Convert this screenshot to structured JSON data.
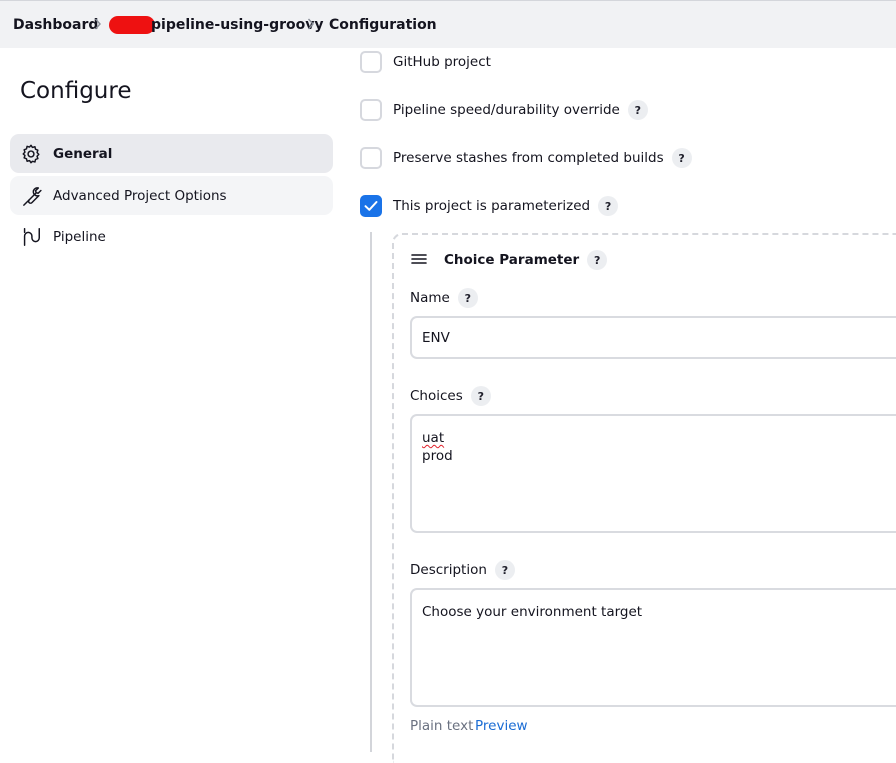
{
  "breadcrumb": {
    "dashboard": "Dashboard",
    "job": "pipeline-using-groovy",
    "current": "Configuration"
  },
  "page": {
    "title": "Configure"
  },
  "sidebar": {
    "items": [
      {
        "label": "General",
        "icon": "gear-icon",
        "active": true
      },
      {
        "label": "Advanced Project Options",
        "icon": "wrench-icon"
      },
      {
        "label": "Pipeline",
        "icon": "pipeline-icon"
      }
    ]
  },
  "options": [
    {
      "label": "GitHub project",
      "checked": false,
      "help": false
    },
    {
      "label": "Pipeline speed/durability override",
      "checked": false,
      "help": true
    },
    {
      "label": "Preserve stashes from completed builds",
      "checked": false,
      "help": true
    },
    {
      "label": "This project is parameterized",
      "checked": true,
      "help": true
    }
  ],
  "help_glyph": "?",
  "parameter": {
    "type": "Choice Parameter",
    "name_label": "Name",
    "name_value": "ENV",
    "choices_label": "Choices",
    "choices": [
      "uat",
      "prod"
    ],
    "description_label": "Description",
    "description_value": "Choose your environment target",
    "format_plain": "Plain text",
    "format_preview": "Preview"
  },
  "colors": {
    "accent": "#1a73e8",
    "link": "#1a6cd4",
    "redaction": "#ee1111"
  }
}
